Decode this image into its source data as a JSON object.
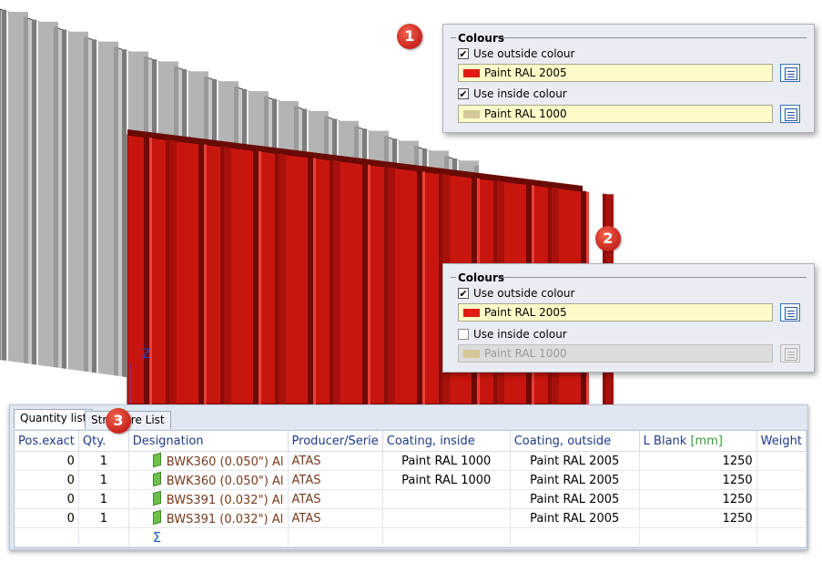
{
  "panels": [
    {
      "badge": "1",
      "header": "Colours",
      "outside": {
        "checked": true,
        "label": "Use outside colour",
        "value": "Paint RAL 2005",
        "color": "#e11a12"
      },
      "inside": {
        "checked": true,
        "label": "Use inside colour",
        "value": "Paint RAL 1000",
        "color": "#d5c797",
        "disabled": false
      }
    },
    {
      "badge": "2",
      "header": "Colours",
      "outside": {
        "checked": true,
        "label": "Use outside colour",
        "value": "Paint RAL 2005",
        "color": "#e11a12"
      },
      "inside": {
        "checked": false,
        "label": "Use inside colour",
        "value": "Paint RAL 1000",
        "color": "#d5c797",
        "disabled": true
      }
    }
  ],
  "list": {
    "badge": "3",
    "tabs": [
      "Quantity list",
      "Structure List"
    ],
    "columns": {
      "pos": "Pos.exact",
      "qty": "Qty.",
      "designation": "Designation",
      "producer": "Producer/Serie",
      "coat_in": "Coating, inside",
      "coat_out": "Coating, outside",
      "lblank": "L Blank",
      "lblank_unit": "[mm]",
      "weight": "Weight"
    },
    "rows": [
      {
        "pos": "0",
        "qty": "1",
        "designation": "BWK360 (0.050\") Al",
        "producer": "ATAS",
        "coat_in": "Paint RAL 1000",
        "coat_out": "Paint RAL 2005",
        "lblank": "1250",
        "weight": ""
      },
      {
        "pos": "0",
        "qty": "1",
        "designation": "BWK360 (0.050\") Al",
        "producer": "ATAS",
        "coat_in": "Paint RAL 1000",
        "coat_out": "Paint RAL 2005",
        "lblank": "1250",
        "weight": ""
      },
      {
        "pos": "0",
        "qty": "1",
        "designation": "BWS391 (0.032\") Al",
        "producer": "ATAS",
        "coat_in": "",
        "coat_out": "Paint RAL 2005",
        "lblank": "1250",
        "weight": ""
      },
      {
        "pos": "0",
        "qty": "1",
        "designation": "BWS391 (0.032\") Al",
        "producer": "ATAS",
        "coat_in": "",
        "coat_out": "Paint RAL 2005",
        "lblank": "1250",
        "weight": ""
      }
    ],
    "sum_symbol": "Σ"
  },
  "icons": [
    "part-icon",
    "colour-picker-icon",
    "sum-icon"
  ]
}
